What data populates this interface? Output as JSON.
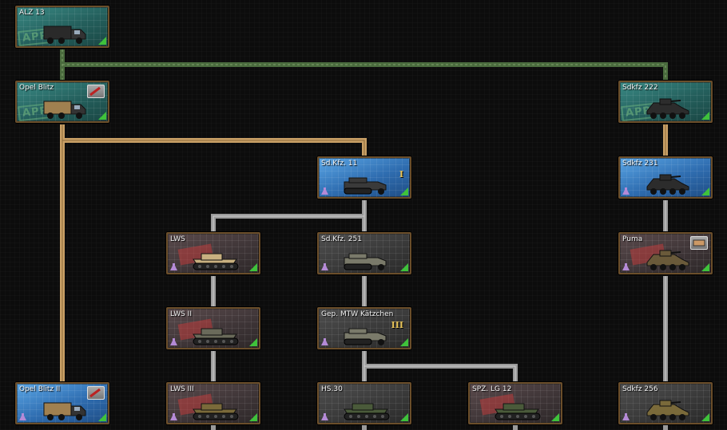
{
  "tech_tree": {
    "nodes": [
      {
        "id": "alz13",
        "name": "ALZ 13",
        "style": "green",
        "stamp": "APP",
        "vehicle": "truck-icon",
        "camo": "#2a2a2a",
        "researched": true
      },
      {
        "id": "opel_blitz",
        "name": "Opel Blitz",
        "style": "green",
        "stamp": "APP",
        "vehicle": "truck-icon",
        "camo": "#a08050",
        "researched": true,
        "badge": "weapon-badge-icon"
      },
      {
        "id": "sdkfz222",
        "name": "Sdkfz 222",
        "style": "green",
        "stamp": "APP",
        "vehicle": "armored-car-icon",
        "camo": "#2c2c2c",
        "researched": true
      },
      {
        "id": "sdkfz11",
        "name": "Sd.Kfz. 11",
        "style": "blue",
        "vehicle": "halftrack-icon",
        "camo": "#3a3a3a",
        "researched": true,
        "tier": "I",
        "flask": true
      },
      {
        "id": "sdkfz231",
        "name": "Sdkfz 231",
        "style": "blue",
        "vehicle": "armored-car-icon",
        "camo": "#2c2c2c",
        "researched": true,
        "flask": true
      },
      {
        "id": "lws",
        "name": "LWS",
        "style": "red",
        "vehicle": "tracked-vehicle-icon",
        "camo": "#c8b080",
        "researched": true,
        "flask": true
      },
      {
        "id": "sdkfz251",
        "name": "Sd.Kfz. 251",
        "style": "gray",
        "vehicle": "halftrack-icon",
        "camo": "#7a7a6a",
        "researched": true,
        "flask": true
      },
      {
        "id": "puma",
        "name": "Puma",
        "style": "red",
        "vehicle": "armored-car-icon",
        "camo": "#6a5a3a",
        "researched": true,
        "flask": true,
        "badge": "ammo-badge-icon"
      },
      {
        "id": "lws2",
        "name": "LWS II",
        "style": "red",
        "vehicle": "tracked-vehicle-icon",
        "camo": "#6a6a5a",
        "researched": true,
        "flask": true
      },
      {
        "id": "katzchen",
        "name": "Gep. MTW Kätzchen",
        "style": "gray",
        "vehicle": "halftrack-icon",
        "camo": "#7a7a6a",
        "researched": true,
        "tier": "III",
        "flask": true
      },
      {
        "id": "opel_blitz2",
        "name": "Opel Blitz II",
        "style": "blue",
        "vehicle": "truck-icon",
        "camo": "#a08050",
        "researched": true,
        "flask": true,
        "badge": "weapon-badge-icon"
      },
      {
        "id": "lws3",
        "name": "LWS III",
        "style": "red",
        "vehicle": "tracked-vehicle-icon",
        "camo": "#7a6a3a",
        "researched": true,
        "flask": true
      },
      {
        "id": "hs30",
        "name": "HS.30",
        "style": "gray",
        "vehicle": "tracked-vehicle-icon",
        "camo": "#4a5a3a",
        "researched": true,
        "flask": true
      },
      {
        "id": "spzlg12",
        "name": "SPZ. LG 12",
        "style": "red",
        "vehicle": "tracked-vehicle-icon",
        "camo": "#4a5a3a",
        "researched": true
      },
      {
        "id": "sdkfz256",
        "name": "Sdkfz 256",
        "style": "gray",
        "vehicle": "armored-car-icon",
        "camo": "#7a6a3a",
        "researched": true,
        "flask": true
      }
    ],
    "connector_colors": {
      "green": "#4a6b3e",
      "tan": "#c9a066",
      "gray": "#9a9a9a"
    }
  }
}
